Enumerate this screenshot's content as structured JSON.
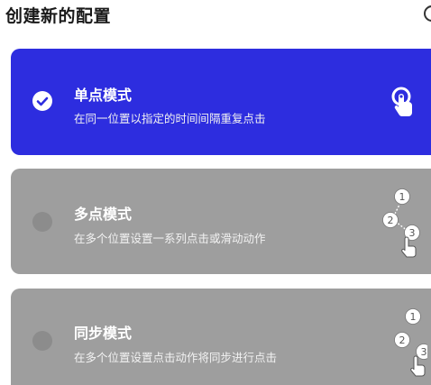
{
  "header": {
    "title": "创建新的配置"
  },
  "modes": [
    {
      "name": "单点模式",
      "description": "在同一位置以指定的时间间隔重复点击",
      "selected": true,
      "icon": "single-tap-icon"
    },
    {
      "name": "多点模式",
      "description": "在多个位置设置一系列点击或滑动动作",
      "selected": false,
      "icon": "multi-tap-icon",
      "steps": [
        "1",
        "2",
        "3"
      ]
    },
    {
      "name": "同步模式",
      "description": "在多个位置设置点击动作将同步进行点击",
      "selected": false,
      "icon": "sync-tap-icon",
      "steps": [
        "1",
        "2",
        "3"
      ]
    }
  ],
  "colors": {
    "selected_card": "#2d2ddf",
    "card": "#9e9e9e",
    "text": "#ffffff"
  }
}
